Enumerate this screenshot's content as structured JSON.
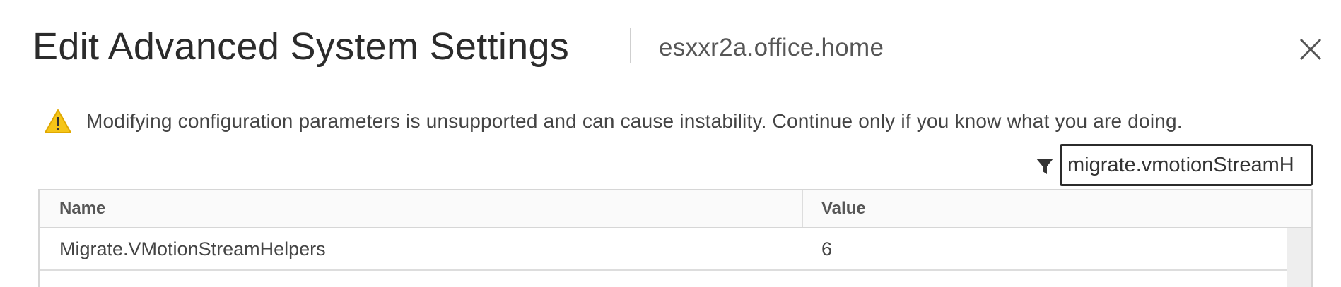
{
  "dialog": {
    "title": "Edit Advanced System Settings",
    "host": "esxxr2a.office.home",
    "close_icon": "close-icon"
  },
  "warning": {
    "icon": "warning-triangle-icon",
    "text": "Modifying configuration parameters is unsupported and can cause instability. Continue only if you know what you are doing.",
    "icon_color": "#f5c518"
  },
  "filter": {
    "icon": "filter-icon",
    "value": "migrate.vmotionStreamH"
  },
  "grid": {
    "columns": [
      "Name",
      "Value"
    ],
    "rows": [
      {
        "name": "Migrate.VMotionStreamHelpers",
        "value": "6"
      }
    ]
  }
}
